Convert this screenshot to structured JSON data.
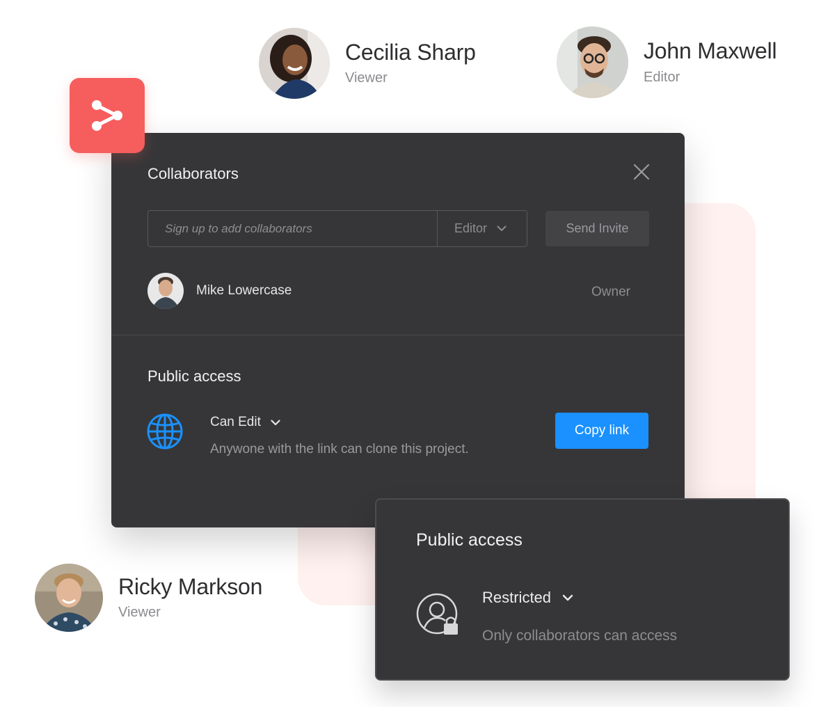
{
  "people": {
    "cecilia": {
      "name": "Cecilia Sharp",
      "role": "Viewer"
    },
    "john": {
      "name": "John Maxwell",
      "role": "Editor"
    },
    "ricky": {
      "name": "Ricky Markson",
      "role": "Viewer"
    }
  },
  "share_icon": "share-nodes-icon",
  "dialog": {
    "title": "Collaborators",
    "invite": {
      "placeholder": "Sign up to add collaborators",
      "role_value": "Editor",
      "send_label": "Send Invite"
    },
    "owner": {
      "name": "Mike Lowercase",
      "role": "Owner"
    },
    "public_access": {
      "title": "Public access",
      "permission": "Can Edit",
      "description": "Anywone with the link can clone this project.",
      "copy_label": "Copy link"
    }
  },
  "restricted_card": {
    "title": "Public access",
    "permission": "Restricted",
    "description": "Only collaborators can access"
  },
  "colors": {
    "accent_blue": "#1a91ff",
    "badge_red": "#f65e5d",
    "dialog_bg": "#363638",
    "backdrop_pink": "#fff1ef"
  }
}
